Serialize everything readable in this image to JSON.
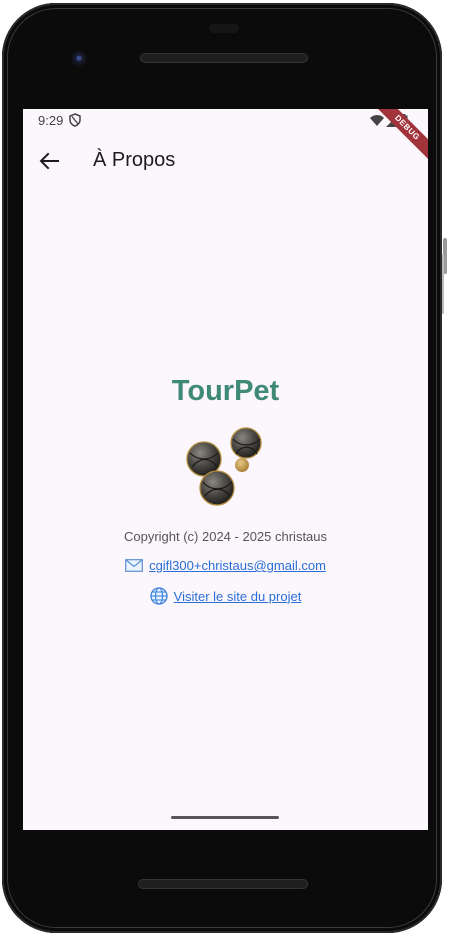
{
  "status_bar": {
    "time": "9:29"
  },
  "debug_banner": "DEBUG",
  "app_bar": {
    "title": "À Propos"
  },
  "about": {
    "app_name": "TourPet",
    "copyright": "Copyright (c) 2024 - 2025 christaus",
    "email": "cgifl300+christaus@gmail.com",
    "website_label": "Visiter le site du projet"
  },
  "icons": {
    "back": "arrow-back-icon",
    "email": "envelope-icon",
    "website": "globe-icon",
    "logo": "petanque-balls-icon"
  },
  "colors": {
    "brand": "#3f8a76",
    "link": "#2a6fd6",
    "background": "#fcf6fd"
  }
}
